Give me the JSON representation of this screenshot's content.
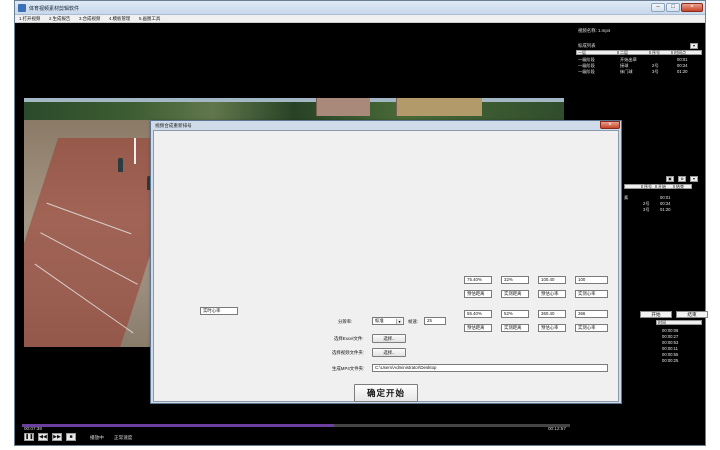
{
  "window": {
    "title": "体育视频素材剪辑软件",
    "min": "–",
    "max": "□",
    "close": "×"
  },
  "menu": [
    "1.打开视频",
    "2.生成报告",
    "3.合成视频",
    "4.模板管理",
    "5.画图工具"
  ],
  "player": {
    "current_time": "00:07:38",
    "total_time": "00:12:57",
    "progress": 0.57,
    "status_playing": "播放中",
    "status_speed": "正常速度",
    "controls": [
      "❚❚",
      "◀◀",
      "▶▶",
      "■"
    ]
  },
  "right_panel": {
    "video_name_label": "视频名称: 1.mp4",
    "mark_list_label": "标成列表",
    "list1_headers": [
      "一层",
      "二层",
      "序号",
      "时间点"
    ],
    "list1_rows": [
      [
        "一级阶段",
        "开始出章",
        "",
        "00:01"
      ],
      [
        "一级阶段",
        "接球",
        "2号",
        "00:24"
      ],
      [
        "一级阶段",
        "抹门球",
        "3号",
        "01:20"
      ]
    ],
    "list2_headers": [
      "",
      "序号",
      "开始",
      "结束"
    ],
    "list2_rows": [
      [
        "素",
        "",
        "00:01"
      ],
      [
        "",
        "2号",
        "00:24"
      ],
      [
        "",
        "3号",
        "01:20"
      ]
    ],
    "start_button": "开始",
    "end_button": "结束",
    "times_header": "时间",
    "times": [
      "00:00:08",
      "00:00:27",
      "00:00:53",
      "00:00:11",
      "00:00:55",
      "00:00:25"
    ]
  },
  "dialog": {
    "title": "视频合成重新排号",
    "close": "×",
    "heart_rate_field": "实时心率",
    "row1_values": [
      "75.40%",
      "32%",
      "100.40",
      "100"
    ],
    "row1_labels": [
      "预估距离",
      "实测距离",
      "预估心率",
      "实测心率"
    ],
    "row2_values": [
      "55.40%",
      "52%",
      "360.40",
      "366"
    ],
    "row2_labels": [
      "预估距离",
      "实测距离",
      "预估心率",
      "实测心率"
    ],
    "resolution_label": "分辨率:",
    "resolution_value": "标准",
    "framerate_label": "帧速:",
    "framerate_value": "25",
    "excel_label": "选择Excel文件:",
    "excel_button": "选择..",
    "video_label": "选择视频文件夹:",
    "video_button": "选择..",
    "output_label": "生成MP4文件夹:",
    "output_path": "C:\\Users\\Administrator\\Desktop",
    "confirm_button": "确定开始"
  }
}
